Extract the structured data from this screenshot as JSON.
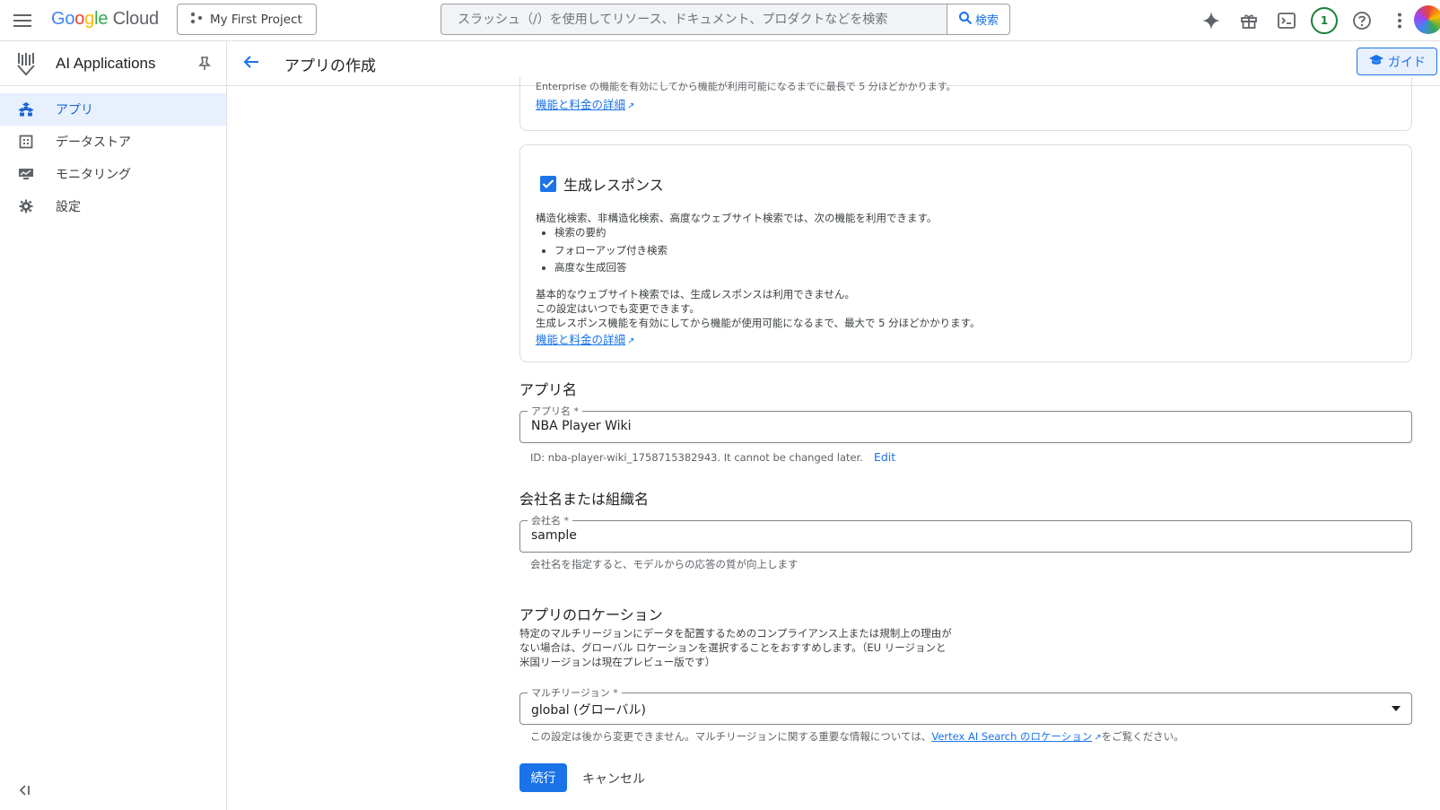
{
  "topbar": {
    "logo": {
      "g1": "Go",
      "g2": "o",
      "g3": "g",
      "g4": "le",
      "cloud": " Cloud"
    },
    "project_label": "My First Project",
    "search_placeholder": "スラッシュ（/）を使用してリソース、ドキュメント、プロダクトなどを検索",
    "search_button": "検索",
    "notification_count": "1"
  },
  "sidebar": {
    "product_title": "AI Applications",
    "items": [
      {
        "label": "アプリ",
        "icon": "apps-icon",
        "active": true
      },
      {
        "label": "データストア",
        "icon": "datastore-icon",
        "active": false
      },
      {
        "label": "モニタリング",
        "icon": "monitoring-icon",
        "active": false
      },
      {
        "label": "設定",
        "icon": "gear-icon",
        "active": false
      }
    ]
  },
  "header": {
    "title": "アプリの作成",
    "guide_button": "ガイド"
  },
  "enterprise_card": {
    "tail_text": "Enterprise の機能を有効にしてから機能が利用可能になるまでに最長で 5 分ほどかかります。",
    "link": "機能と料金の詳細"
  },
  "generative_card": {
    "checkbox_label": "生成レスポンス",
    "checked": true,
    "desc": "構造化検索、非構造化検索、高度なウェブサイト検索では、次の機能を利用できます。",
    "bullets": [
      "検索の要約",
      "フォローアップ付き検索",
      "高度な生成回答"
    ],
    "note_lines": [
      "基本的なウェブサイト検索では、生成レスポンスは利用できません。",
      "この設定はいつでも変更できます。",
      "生成レスポンス機能を有効にしてから機能が使用可能になるまで、最大で 5 分ほどかかります。"
    ],
    "link": "機能と料金の詳細"
  },
  "app_name": {
    "section_title": "アプリ名",
    "field_label": "アプリ名 *",
    "value": "NBA Player Wiki",
    "id_helper": "ID: nba-player-wiki_1758715382943. It cannot be changed later.",
    "edit_link": "Edit"
  },
  "company": {
    "section_title": "会社名または組織名",
    "field_label": "会社名 *",
    "value": "sample",
    "helper": "会社名を指定すると、モデルからの応答の質が向上します"
  },
  "location": {
    "section_title": "アプリのロケーション",
    "desc_lines": [
      "特定のマルチリージョンにデータを配置するためのコンプライアンス上または規制上の理由が",
      "ない場合は、グローバル ロケーションを選択することをおすすめします。（EU リージョンと",
      "米国リージョンは現在プレビュー版です）"
    ],
    "select_label": "マルチリージョン *",
    "select_value": "global (グローバル)",
    "helper_pre": "この設定は後から変更できません。マルチリージョンに関する重要な情報については、",
    "helper_link": "Vertex AI Search のロケーション",
    "helper_post": "をご覧ください。"
  },
  "actions": {
    "continue": "続行",
    "cancel": "キャンセル"
  },
  "colors": {
    "accent": "#1a73e8",
    "active_bg": "#e8f0fe",
    "notification": "#188038"
  }
}
